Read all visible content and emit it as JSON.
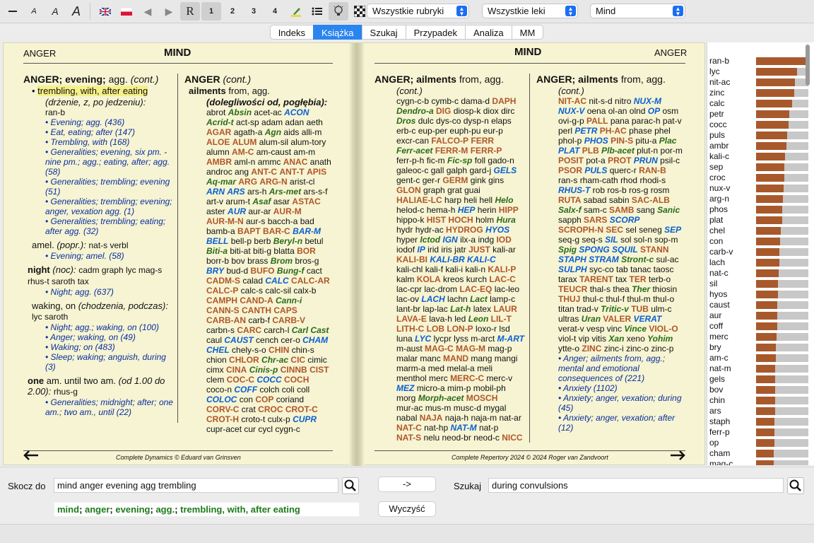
{
  "toolbar": {
    "font_small_a": "A",
    "font_medium_a": "A",
    "font_large_a": "A",
    "rubric_mode": "R",
    "degree_1": "1",
    "degree_2": "2",
    "degree_3": "3",
    "degree_4": "4",
    "rubric_select": "Wszystkie rubryki",
    "remedy_select": "Wszystkie leki",
    "chapter_select": "Mind"
  },
  "tabs": [
    "Indeks",
    "Książka",
    "Szukaj",
    "Przypadek",
    "Analiza",
    "MM"
  ],
  "active_tab": "Książka",
  "left_page": {
    "corner_label": "ANGER",
    "title": "MIND",
    "footer": "Complete Dynamics © Eduard van Grinsven",
    "col1": {
      "heading": "ANGER; evening;",
      "heading_agg": "agg.",
      "heading_cont": "(cont.)",
      "selected_rubric": "trembling, with, after eating",
      "selected_translation": "(drżenie, z, po jedzeniu):",
      "selected_remedy": "ran-b",
      "refs1": [
        "Evening; agg. (436)",
        "Eat, eating; after (147)",
        "Trembling, with (168)",
        "Generalities; evening, six pm. - nine pm.; agg.; eating, after; agg. (58)",
        "Generalities; trembling; evening (51)",
        "Generalities; trembling; evening; anger, vexation agg. (1)",
        "Generalities; trembling; eating; after agg. (32)"
      ],
      "amel_label": "amel.",
      "amel_translation": "(popr.):",
      "amel_remedies": "nat-s verbl",
      "refs2": [
        "Evening; amel. (58)"
      ],
      "night_label": "night",
      "night_translation": "(noc):",
      "night_remedies": "cadm graph lyc mag-s rhus-t saroth tax",
      "refs3": [
        "Night; agg. (637)"
      ],
      "waking_label": "waking, on",
      "waking_translation": "(chodzenia, podczas):",
      "waking_remedies": "lyc saroth",
      "refs4": [
        "Night; agg.; waking, on (100)",
        "Anger; waking, on (49)",
        "Waking; on (483)",
        "Sleep; waking; anguish, during (3)"
      ],
      "one_label": "one",
      "one_text": "am. until two am.",
      "one_translation": "(od 1.00 do 2.00):",
      "one_remedies": "rhus-g",
      "refs5": [
        "Generalities; midnight; after; one am.; two am., until (22)"
      ]
    },
    "col2": {
      "heading": "ANGER",
      "heading_cont": "(cont.)",
      "sub": "ailments",
      "sub_from": "from, agg.",
      "translation": "(dolegliwości od, pogłębia):",
      "remedy_lines": [
        "abrot |Absin:1| acet-ac |ACON:3|",
        "|Acrid-t:1| act-sp adam adan aeth",
        "|AGAR:2| agath-a |Agn:1| aids alli-m",
        "|ALOE:2| |ALUM:2| alum-sil alum-tory",
        "alumn |AM-C:2| am-caust am-m",
        "|AMBR:2| aml-n ammc |ANAC:2| anath",
        "androc ang |ANT-C:2| |ANT-T:2| |APIS:2|",
        "|Aq-mar:1| |ARG:2| |ARG-N:2| arist-cl",
        "|ARN:3| |ARS:3| ars-h |Ars-met:1| ars-s-f",
        "art-v arum-t |Asaf:1| asar |ASTAC:2|",
        "aster |AUR:3| aur-ar |AUR-M:2|",
        "|AUR-M-N:2| aur-s bacch-a bad",
        "bamb-a |BAPT:2| |BAR-C:2| |BAR-M:3|",
        "|BELL:3| bell-p berb |Beryl-n:1| betul",
        "|Biti-a:1| biti-at biti-g blatta |BOR:2|",
        "borr-b bov brass |Brom:1| bros-g",
        "|BRY:3| bud-d |BUFO:2| |Bung-f:1| cact",
        "|CADM-S:2| calad |CALC:3| |CALC-AR:2|",
        "|CALC-P:2| calc-s calc-sil calx-b",
        "|CAMPH:2| |CAND-A:2| |Cann-i:1|",
        "|CANN-S:2| |CANTH:2| |CAPS:2|",
        "|CARB-AN:2| carb-f |CARB-V:2|",
        "carbn-s |CARC:2| carch-l |Carl:1| |Cast:1|",
        "caul |CAUST:3| cench cer-o |CHAM:3|",
        "|CHEL:3| chely-s-o |CHIN:2| chin-s",
        "chion |CHLOR:2| |Chr-ac:1| |CIC:2| cimic",
        "cimx |CINA:2| |Cinis-p:1| |CINNB:2| |CIST:2|",
        "clem |COC-C:2| |COCC:3| |COCH:2|",
        "coco-n |COFF:3| colch coli coll",
        "|COLOC:3| con |COP:2| coriand",
        "|CORV-C:2| crat |CROC:2| |CROT-C:2|",
        "|CROT-H:2| croto-t culx-p |CUPR:3|",
        "cupr-acet cur cycl cygn-c"
      ]
    }
  },
  "right_page": {
    "corner_label": "ANGER",
    "title": "MIND",
    "footer": "Complete Repertory 2024 © 2024 Roger van Zandvoort",
    "col1": {
      "heading": "ANGER; ailments",
      "heading_from": "from, agg.",
      "heading_cont": "(cont.)",
      "remedy_lines": [
        "cygn-c-b cymb-c dama-d |DAPH:2|",
        "|Dendro-a:1| |DIG:2| diosp-k diox dirc",
        "|Dros:1| dulc dys-co dysp-n elaps",
        "erb-c eup-per euph-pu eur-p",
        "excr-can |FALCO-P:2| |FERR:2|",
        "|Ferr-acet:1| |FERR-M:2| |FERR-P:2|",
        "ferr-p-h fic-m |Fic-sp:1| foll gado-n",
        "galeoc-c gall galph gard-j |GELS:3|",
        "gent-c ger-r |GERM:2| gink gins",
        "|GLON:2| graph grat guai",
        "|HALIAE-LC:2| harp heli hell |Helo:1|",
        "helod-c hema-h |HEP:3| herin |HIPP:2|",
        "hippo-k |HIST:2| |HOCH:2| holm |Hura:1|",
        "hydr hydr-ac |HYDROG:2| |HYOS:3|",
        "hyper |Ictod:1| |IGN:3| ilx-a indg |IOD:2|",
        "iodof |IP:3| irid iris jatr |JUST:2| kali-ar",
        "|KALI-BI:2| |KALI-BR:3| |KALI-C:3|",
        "kali-chl kali-f kali-i kali-n |KALI-P:2|",
        "kalm |KOLA:2| kreos kurch |LAC-C:2|",
        "lac-cpr lac-drom |LAC-EQ:2| lac-leo",
        "lac-ov |LACH:3| lachn |Lact:1| lamp-c",
        "lant-br lap-lac |Lat-h:1| latex |LAUR:2|",
        "|LAVA-E:2| lava-h led |Leon:1| |LIL-T:2|",
        "|LITH-C:2| |LOB:2| |LON-P:2| loxo-r lsd",
        "luna |LYC:3| lycpr lyss m-arct |M-ART:3|",
        "m-aust |MAG-C:2| |MAG-M:2| mag-p",
        "malar manc |MAND:2| mang mangi",
        "marm-a med melal-a meli",
        "menthol merc |MERC-C:2| merc-v",
        "|MEZ:3| micro-a mim-p mobil-ph",
        "morg |Morph-acet:1| |MOSCH:2|",
        "mur-ac mus-m musc-d mygal",
        "nabal |NAJA:2| naja-h naja-m nat-ar",
        "|NAT-C:2| nat-hp |NAT-M:3| nat-p",
        "|NAT-S:2| nelu neod-br neod-c |NICC:2|"
      ]
    },
    "col2": {
      "heading": "ANGER; ailments",
      "heading_from": "from, agg.",
      "heading_cont": "(cont.)",
      "remedy_lines": [
        "|NIT-AC:2| nit-s-d nitro |NUX-M:3|",
        "|NUX-V:3| oena ol-an olnd |OP:3| osm",
        "ovi-g-p |PALL:2| pana parac-h pat-v",
        "perl |PETR:3| |PH-AC:2| phase phel",
        "phol-p |PHOS:3| |PIN-S:2| pitu-a |Plac:1|",
        "|PLAT:3| |PLB:2| |Plb-acet:1| plut-n por-m",
        "|POSIT:2| pot-a |PROT:2| |PRUN:3| psil-c",
        "|PSOR:2| |PULS:3| querc-r |RAN-B:2|",
        "ran-s rham-cath rhod rhodi-s",
        "|RHUS-T:3| rob ros-b ros-g rosm",
        "|RUTA:2| sabad sabin |SAC-ALB:2|",
        "|Salx-f:1| sam-c |SAMB:2| sang |Sanic:1|",
        "sapph |SARS:2| |SCORP:3|",
        "|SCROPH-N:2| |SEC:2| sel seneg |SEP:3|",
        "seq-g seq-s |SIL:3| sol sol-n sop-m",
        "|Spig:1| |SPONG:3| |SQUIL:3| |STANN:2|",
        "|STAPH:3| |STRAM:3| |Stront-c:1| sul-ac",
        "|SULPH:3| syc-co tab tanac taosc",
        "tarax |TARENT:2| tax |TER:2| terb-o",
        "|TEUCR:2| thal-s thea |Ther:1| thiosin",
        "|THUJ:2| thul-c thul-f thul-m thul-o",
        "titan trad-v |Tritic-v:1| |TUB:2| ulm-c",
        "ultras |Uran:1| |VALER:2| |VERAT:3|",
        "verat-v vesp vinc |Vince:1| |VIOL-O:2|",
        "viol-t vip vitis |Xan:1| xeno |Yohim:1|",
        "ytte-o |ZINC:2| zinc-i zinc-o zinc-p"
      ],
      "refs": [
        "Anger; ailments from, agg.; mental and emotional consequences of (221)",
        "Anxiety (1102)",
        "Anxiety; anger, vexation; during (45)",
        "Anxiety; anger, vexation; after (12)"
      ]
    }
  },
  "sidebar": {
    "items": [
      {
        "name": "ran-b",
        "value": 1.0
      },
      {
        "name": "lyc",
        "value": 0.78
      },
      {
        "name": "nit-ac",
        "value": 0.74
      },
      {
        "name": "zinc",
        "value": 0.73
      },
      {
        "name": "calc",
        "value": 0.69
      },
      {
        "name": "petr",
        "value": 0.64
      },
      {
        "name": "cocc",
        "value": 0.62
      },
      {
        "name": "puls",
        "value": 0.59
      },
      {
        "name": "ambr",
        "value": 0.58
      },
      {
        "name": "kali-c",
        "value": 0.55
      },
      {
        "name": "sep",
        "value": 0.54
      },
      {
        "name": "croc",
        "value": 0.54
      },
      {
        "name": "nux-v",
        "value": 0.53
      },
      {
        "name": "arg-n",
        "value": 0.51
      },
      {
        "name": "phos",
        "value": 0.5
      },
      {
        "name": "plat",
        "value": 0.5
      },
      {
        "name": "chel",
        "value": 0.47
      },
      {
        "name": "con",
        "value": 0.46
      },
      {
        "name": "carb-v",
        "value": 0.45
      },
      {
        "name": "lach",
        "value": 0.44
      },
      {
        "name": "nat-c",
        "value": 0.43
      },
      {
        "name": "sil",
        "value": 0.42
      },
      {
        "name": "hyos",
        "value": 0.42
      },
      {
        "name": "caust",
        "value": 0.41
      },
      {
        "name": "aur",
        "value": 0.4
      },
      {
        "name": "coff",
        "value": 0.4
      },
      {
        "name": "merc",
        "value": 0.39
      },
      {
        "name": "bry",
        "value": 0.38
      },
      {
        "name": "am-c",
        "value": 0.38
      },
      {
        "name": "nat-m",
        "value": 0.37
      },
      {
        "name": "gels",
        "value": 0.37
      },
      {
        "name": "bov",
        "value": 0.36
      },
      {
        "name": "chin",
        "value": 0.36
      },
      {
        "name": "ars",
        "value": 0.36
      },
      {
        "name": "staph",
        "value": 0.35
      },
      {
        "name": "ferr-p",
        "value": 0.35
      },
      {
        "name": "op",
        "value": 0.35
      },
      {
        "name": "cham",
        "value": 0.34
      },
      {
        "name": "mag-c",
        "value": 0.34
      }
    ]
  },
  "bottom": {
    "jump_label": "Skocz do",
    "jump_value": "mind anger evening agg trembling",
    "arrow_button": "->",
    "search_label": "Szukaj",
    "search_value": "during convulsions",
    "clear_button": "Wyczyść",
    "path": [
      {
        "text": "mind",
        "sep": "; "
      },
      {
        "text": "anger",
        "sep": "; "
      },
      {
        "text": "evening",
        "sep": "; "
      },
      {
        "text": "agg.",
        "sep": "; "
      },
      {
        "text": "trembling, with, after eating",
        "sep": ""
      }
    ]
  },
  "colors": {
    "grade3": "#0b5fd1",
    "grade2": "#b0562a",
    "grade1": "#2b6a1a",
    "bar": "#a8592c",
    "accent": "#2a85f0"
  }
}
